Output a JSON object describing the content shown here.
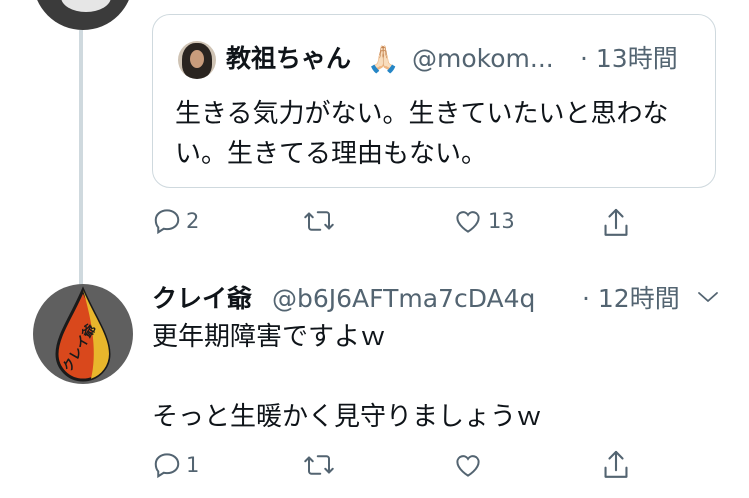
{
  "quote_tweet": {
    "display_name": "教祖ちゃん",
    "emoji": "🙏🏻",
    "handle": "@mokom...",
    "time": "· 13時間",
    "text": "生きる気力がない。生きていたいと思わない。生きてる理由もない。",
    "avatar_icon": "user-avatar"
  },
  "quote_actions": {
    "reply_count": "2",
    "retweet_count": "",
    "like_count": "13"
  },
  "reply_tweet": {
    "display_name": "クレイ爺",
    "handle": "@b6J6AFTma7cDA4q",
    "time": "· 12時間",
    "line1": "更年期障害ですよｗ",
    "line2": "そっと生暖かく見守りましょうｗ",
    "avatar_text": "クレイ爺"
  },
  "reply_actions": {
    "reply_count": "1",
    "retweet_count": "",
    "like_count": ""
  },
  "colors": {
    "secondary_text": "#536471",
    "border": "#cfd9de",
    "icon": "#536471"
  }
}
